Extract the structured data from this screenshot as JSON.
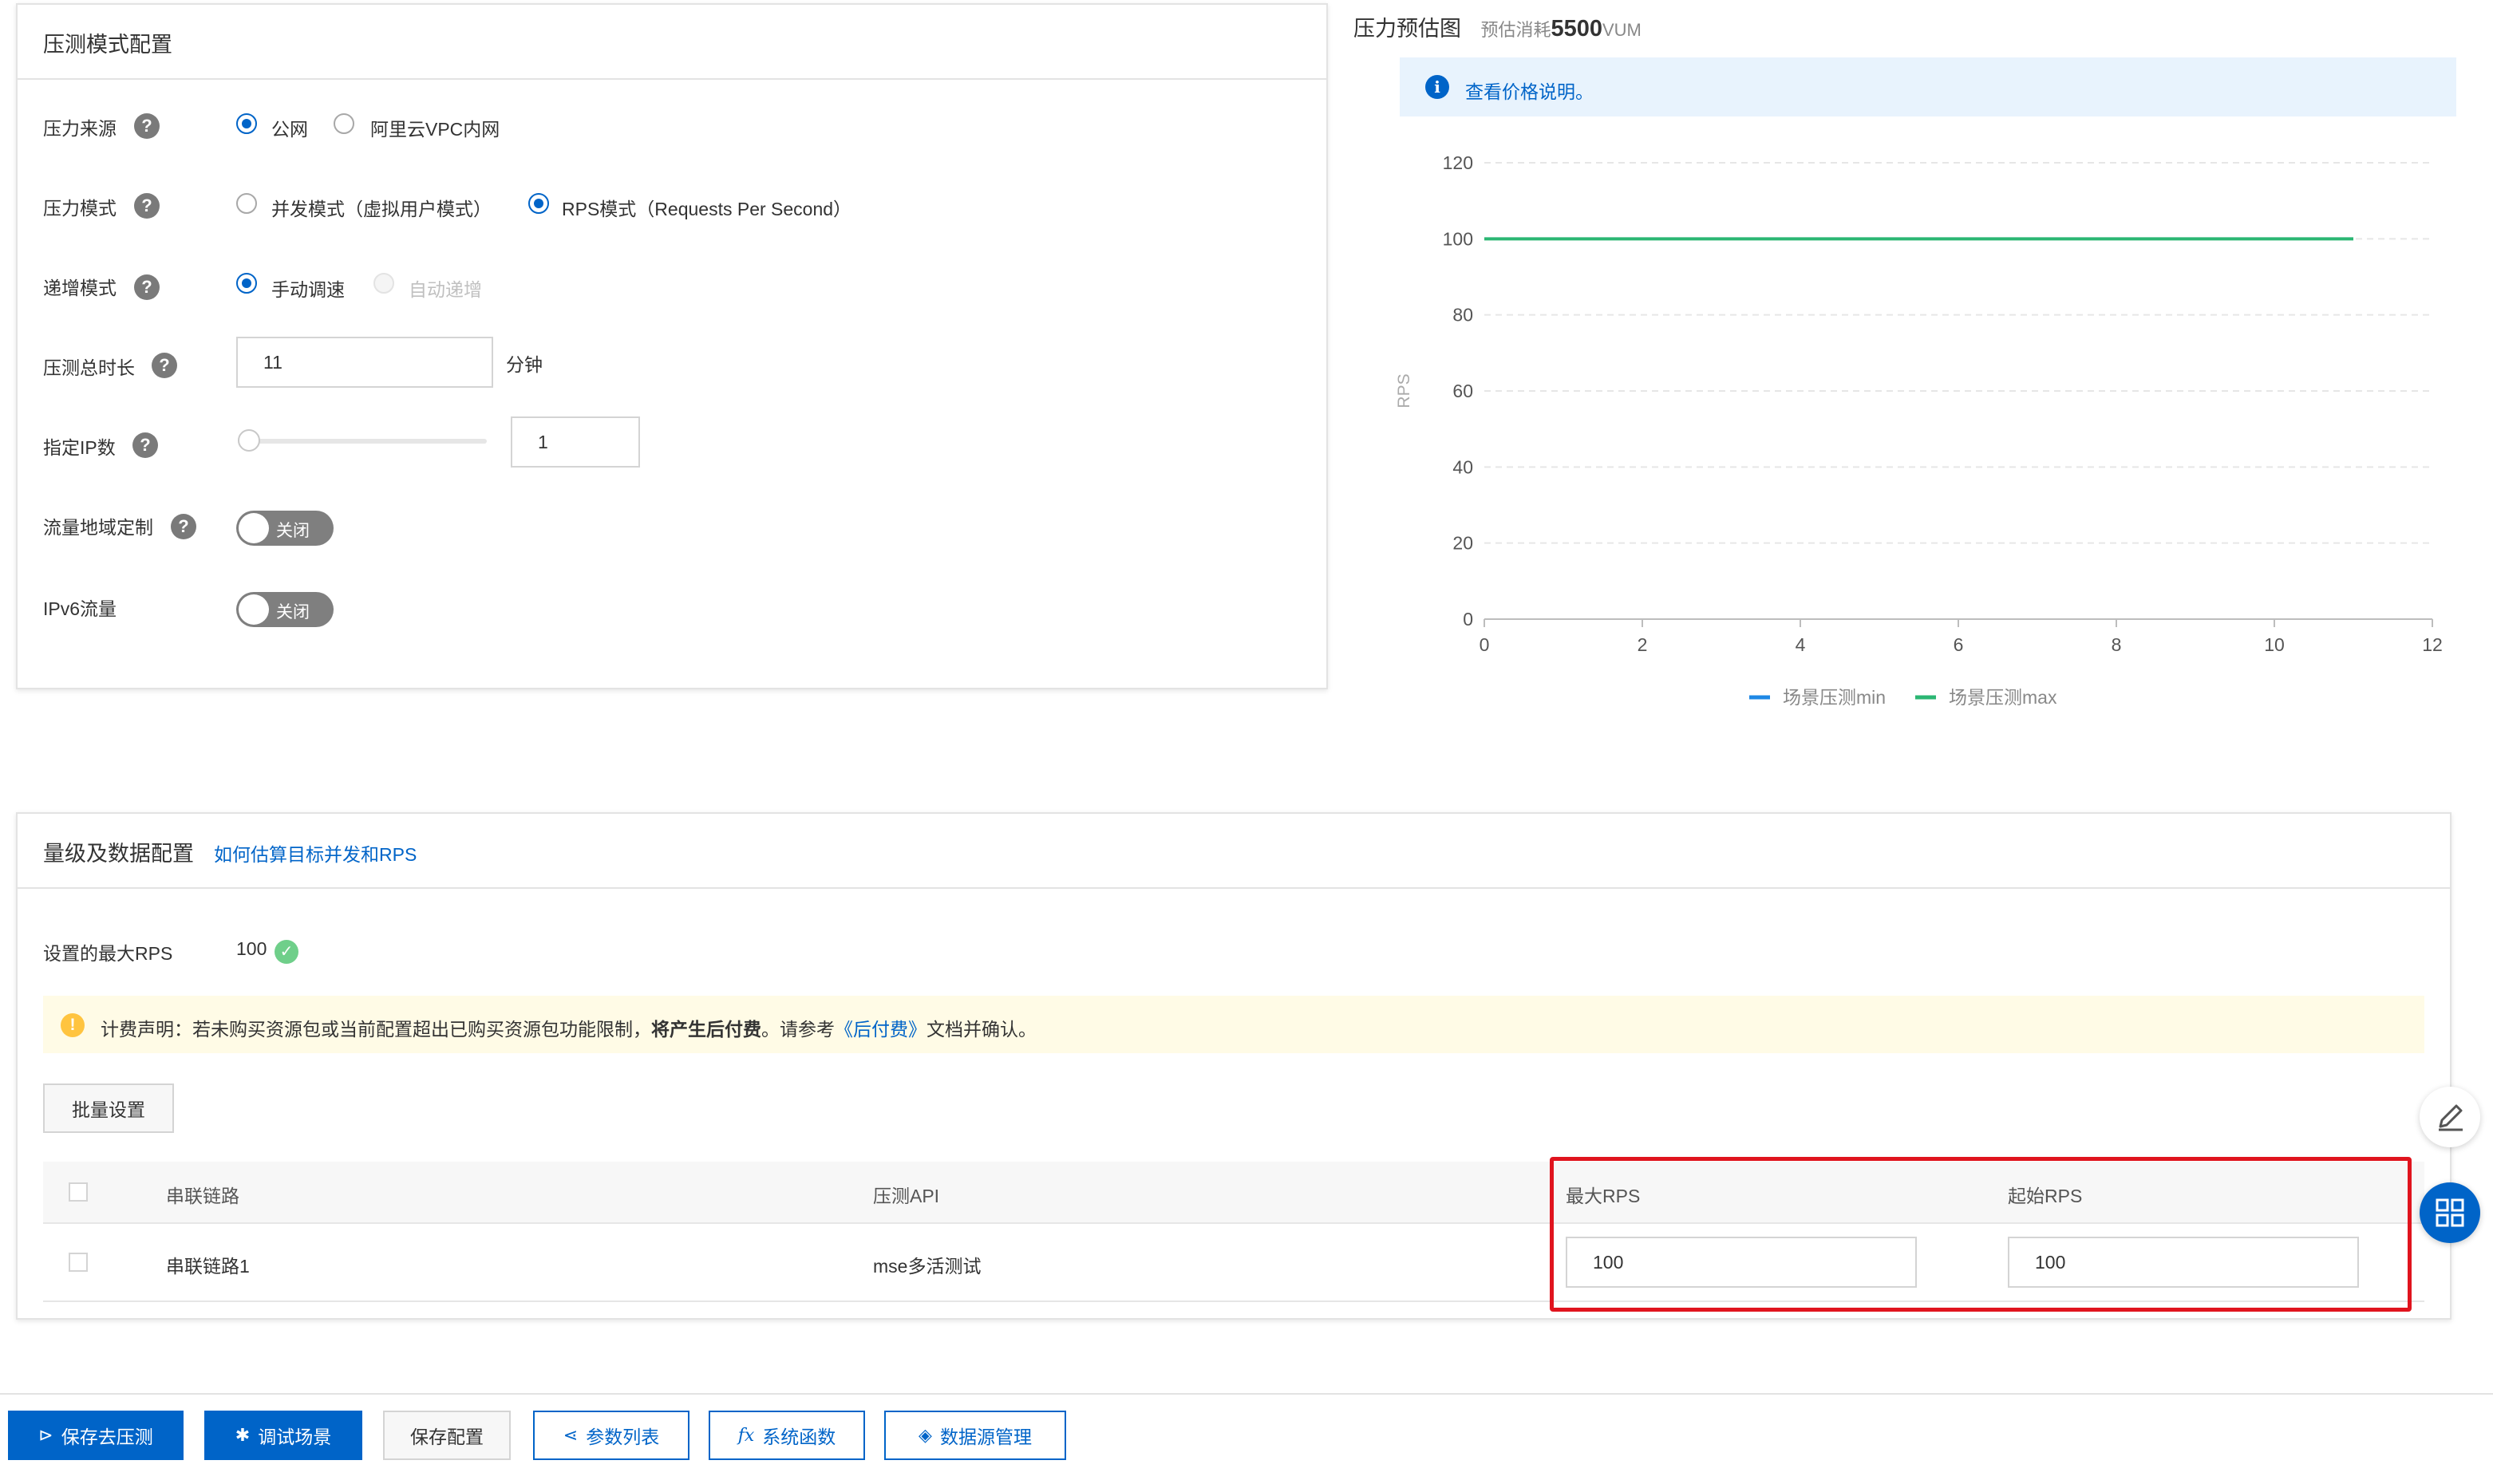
{
  "mode_config": {
    "title": "压测模式配置",
    "source": {
      "label": "压力来源",
      "options": [
        "公网",
        "阿里云VPC内网"
      ],
      "selected": "公网"
    },
    "pressure_mode": {
      "label": "压力模式",
      "options": [
        "并发模式（虚拟用户模式）",
        "RPS模式（Requests Per Second）"
      ],
      "selected": "RPS模式（Requests Per Second）"
    },
    "ramp_mode": {
      "label": "递增模式",
      "options": [
        "手动调速",
        "自动递增"
      ],
      "selected": "手动调速"
    },
    "duration": {
      "label": "压测总时长",
      "value": "11",
      "unit": "分钟"
    },
    "ip_count": {
      "label": "指定IP数",
      "value": "1",
      "slider_level": 0
    },
    "region_custom": {
      "label": "流量地域定制",
      "state": "关闭"
    },
    "ipv6": {
      "label": "IPv6流量",
      "state": "关闭"
    }
  },
  "forecast": {
    "title": "压力预估图",
    "cost_prefix": "预估消耗",
    "cost_value": "5500",
    "cost_unit": "VUM",
    "price_link": "查看价格说明。"
  },
  "chart_data": {
    "type": "line",
    "ylabel": "RPS",
    "xlim": [
      0,
      12
    ],
    "ylim": [
      0,
      120
    ],
    "x_ticks": [
      "0",
      "2",
      "4",
      "6",
      "8",
      "10",
      "12"
    ],
    "y_ticks": [
      "0",
      "20",
      "40",
      "60",
      "80",
      "100",
      "120"
    ],
    "grid": true,
    "legend_position": "bottom",
    "series": [
      {
        "name": "场景压测min",
        "color": "#1e88e5",
        "x": [],
        "y": []
      },
      {
        "name": "场景压测max",
        "color": "#2bb673",
        "x": [
          0,
          11
        ],
        "y": [
          100,
          100
        ]
      }
    ]
  },
  "volume_config": {
    "title": "量级及数据配置",
    "help_link": "如何估算目标并发和RPS",
    "max_rps_label": "设置的最大RPS",
    "max_rps_value": "100",
    "notice": {
      "prefix": "计费声明：若未购买资源包或当前配置超出已购买资源包功能限制，",
      "bold": "将产生后付费",
      "middle": "。请参考",
      "link": "《后付费》",
      "suffix": "文档并确认。"
    },
    "batch_button": "批量设置",
    "table": {
      "headers": [
        "串联链路",
        "压测API",
        "最大RPS",
        "起始RPS"
      ],
      "rows": [
        {
          "link": "串联链路1",
          "api": "mse多活测试",
          "max_rps": "100",
          "start_rps": "100"
        }
      ]
    }
  },
  "footer": {
    "save_test": "保存去压测",
    "debug": "调试场景",
    "save_config": "保存配置",
    "params": "参数列表",
    "functions": "系统函数",
    "datasource": "数据源管理"
  },
  "colors": {
    "primary": "#0064c8",
    "highlight": "#e0141e",
    "max_series": "#2bb673",
    "min_series": "#1e88e5"
  }
}
